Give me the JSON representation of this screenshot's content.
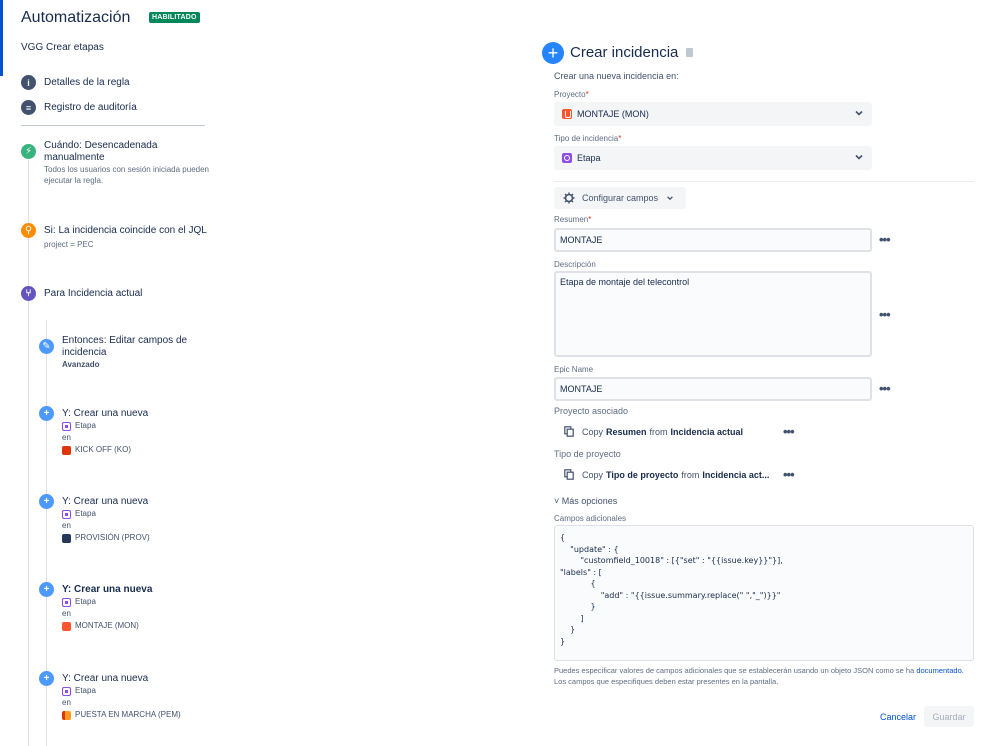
{
  "app": {
    "title": "Automatización",
    "status_badge": "HABILITADO",
    "rule_name": "VGG Crear etapas"
  },
  "nav": [
    {
      "label": "Detalles de la regla",
      "icon": "info-icon"
    },
    {
      "label": "Registro de auditoría",
      "icon": "list-icon"
    }
  ],
  "flow": {
    "trigger": {
      "title": "Cuándo: Desencadenada manualmente",
      "desc": "Todos los usuarios con sesión iniciada pueden ejecutar la regla."
    },
    "condition": {
      "title": "Si: La incidencia coincide con el JQL",
      "desc": "project = PEC"
    },
    "branch": {
      "title": "Para Incidencia actual"
    },
    "edit_action": {
      "title": "Entonces: Editar campos de incidencia",
      "desc": "Avanzado"
    },
    "create_actions": [
      {
        "title": "Y: Crear una nueva",
        "type": "Etapa",
        "in": "en",
        "project": "KICK OFF (KO)"
      },
      {
        "title": "Y: Crear una nueva",
        "type": "Etapa",
        "in": "en",
        "project": "PROVISIÓN (PROV)"
      },
      {
        "title": "Y: Crear una nueva",
        "type": "Etapa",
        "in": "en",
        "project": "MONTAJE (MON)"
      },
      {
        "title": "Y: Crear una nueva",
        "type": "Etapa",
        "in": "en",
        "project": "PUESTA EN MARCHA (PEM)"
      }
    ]
  },
  "form": {
    "title": "Crear incidencia",
    "intro": "Crear una nueva incidencia en:",
    "project_label": "Proyecto",
    "project_value": "MONTAJE (MON)",
    "issue_type_label": "Tipo de incidencia",
    "issue_type_value": "Etapa",
    "configure_fields": "Configurar campos",
    "summary_label": "Resumen",
    "summary_value": "MONTAJE",
    "description_label": "Descripción",
    "description_value": "Etapa de montaje del telecontrol",
    "epic_name_label": "Epic Name",
    "epic_name_value": "MONTAJE",
    "linked_project_label": "Proyecto asociado",
    "linked_copy": {
      "a": "Copy",
      "b": "Resumen",
      "c": "from",
      "d": "Incidencia actual"
    },
    "project_type_label": "Tipo de proyecto",
    "project_type_copy": {
      "a": "Copy",
      "b": "Tipo de proyecto",
      "c": "from",
      "d": "Incidencia act..."
    },
    "more_options": "Más opciones",
    "additional_fields_label": "Campos adicionales",
    "additional_fields_json": "{\n    \"update\" : {\n        \"customfield_10018\" : [{\"set\" : \"{{issue.key}}\"}],\n\"labels\" : [\n            {\n                \"add\" : \"{{issue.summary.replace(\" \",\"_\")}}\"\n            }\n        ]\n    }\n}",
    "help_text": "Puedes especificar valores de campos adicionales que se establecerán usando un objeto JSON como se ha",
    "help_link": "documentado.",
    "help_text_2": "Los campos que especifiques deben estar presentes en la pantalla.",
    "cancel": "Cancelar",
    "save": "Guardar"
  },
  "colors": {
    "brand": "#0052cc",
    "badge": "#00875a",
    "trigger": "#36b37e",
    "condition": "#ff8b00",
    "branch": "#6554c0",
    "action": "#4c9aff"
  }
}
